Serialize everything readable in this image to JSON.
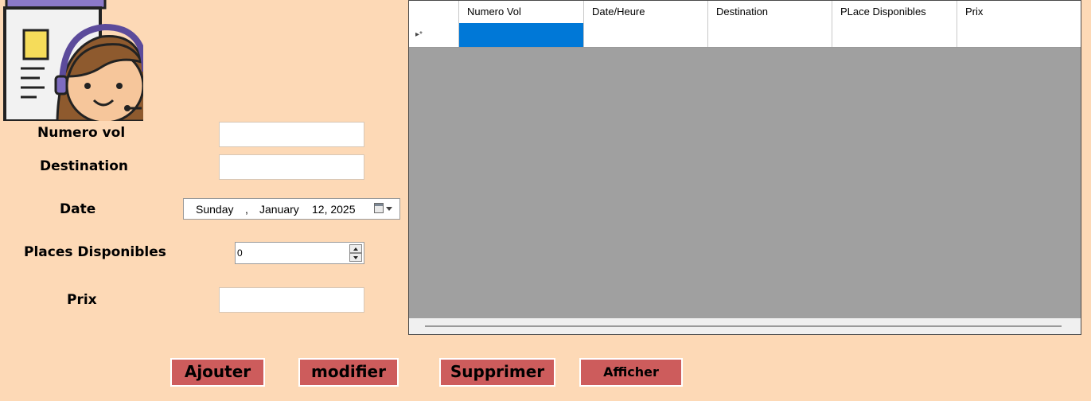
{
  "form": {
    "numero_label": "Numero vol",
    "destination_label": "Destination",
    "date_label": "Date",
    "places_label": "Places Disponibles",
    "prix_label": "Prix",
    "date_day": "Sunday",
    "date_sep": ",",
    "date_month": "January",
    "date_daynum_year": "12, 2025",
    "places_value": "0"
  },
  "grid": {
    "columns": [
      "Numero  Vol",
      "Date/Heure",
      "Destination",
      "PLace Disponibles",
      "Prix"
    ],
    "new_row_marker": "▸*"
  },
  "buttons": {
    "ajouter": "Ajouter",
    "modifier": "modifier",
    "supprimer": "Supprimer",
    "afficher": "Afficher"
  },
  "colors": {
    "background": "#FDD9B6",
    "button": "#CD5C5C",
    "selection": "#0078D7",
    "grid_empty": "#A0A0A0"
  },
  "icons": [
    "support-agent-icon"
  ]
}
